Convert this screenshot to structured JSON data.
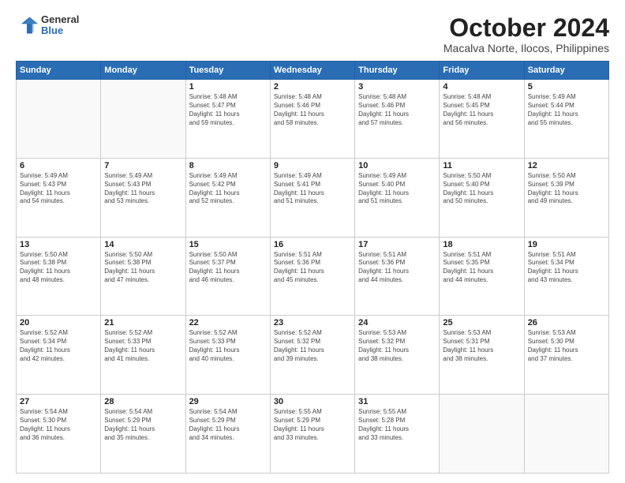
{
  "logo": {
    "general": "General",
    "blue": "Blue"
  },
  "title": {
    "month": "October 2024",
    "location": "Macalva Norte, Ilocos, Philippines"
  },
  "weekdays": [
    "Sunday",
    "Monday",
    "Tuesday",
    "Wednesday",
    "Thursday",
    "Friday",
    "Saturday"
  ],
  "weeks": [
    [
      {
        "day": "",
        "info": ""
      },
      {
        "day": "",
        "info": ""
      },
      {
        "day": "1",
        "info": "Sunrise: 5:48 AM\nSunset: 5:47 PM\nDaylight: 11 hours\nand 59 minutes."
      },
      {
        "day": "2",
        "info": "Sunrise: 5:48 AM\nSunset: 5:46 PM\nDaylight: 11 hours\nand 58 minutes."
      },
      {
        "day": "3",
        "info": "Sunrise: 5:48 AM\nSunset: 5:46 PM\nDaylight: 11 hours\nand 57 minutes."
      },
      {
        "day": "4",
        "info": "Sunrise: 5:48 AM\nSunset: 5:45 PM\nDaylight: 11 hours\nand 56 minutes."
      },
      {
        "day": "5",
        "info": "Sunrise: 5:49 AM\nSunset: 5:44 PM\nDaylight: 11 hours\nand 55 minutes."
      }
    ],
    [
      {
        "day": "6",
        "info": "Sunrise: 5:49 AM\nSunset: 5:43 PM\nDaylight: 11 hours\nand 54 minutes."
      },
      {
        "day": "7",
        "info": "Sunrise: 5:49 AM\nSunset: 5:43 PM\nDaylight: 11 hours\nand 53 minutes."
      },
      {
        "day": "8",
        "info": "Sunrise: 5:49 AM\nSunset: 5:42 PM\nDaylight: 11 hours\nand 52 minutes."
      },
      {
        "day": "9",
        "info": "Sunrise: 5:49 AM\nSunset: 5:41 PM\nDaylight: 11 hours\nand 51 minutes."
      },
      {
        "day": "10",
        "info": "Sunrise: 5:49 AM\nSunset: 5:40 PM\nDaylight: 11 hours\nand 51 minutes."
      },
      {
        "day": "11",
        "info": "Sunrise: 5:50 AM\nSunset: 5:40 PM\nDaylight: 11 hours\nand 50 minutes."
      },
      {
        "day": "12",
        "info": "Sunrise: 5:50 AM\nSunset: 5:39 PM\nDaylight: 11 hours\nand 49 minutes."
      }
    ],
    [
      {
        "day": "13",
        "info": "Sunrise: 5:50 AM\nSunset: 5:38 PM\nDaylight: 11 hours\nand 48 minutes."
      },
      {
        "day": "14",
        "info": "Sunrise: 5:50 AM\nSunset: 5:38 PM\nDaylight: 11 hours\nand 47 minutes."
      },
      {
        "day": "15",
        "info": "Sunrise: 5:50 AM\nSunset: 5:37 PM\nDaylight: 11 hours\nand 46 minutes."
      },
      {
        "day": "16",
        "info": "Sunrise: 5:51 AM\nSunset: 5:36 PM\nDaylight: 11 hours\nand 45 minutes."
      },
      {
        "day": "17",
        "info": "Sunrise: 5:51 AM\nSunset: 5:36 PM\nDaylight: 11 hours\nand 44 minutes."
      },
      {
        "day": "18",
        "info": "Sunrise: 5:51 AM\nSunset: 5:35 PM\nDaylight: 11 hours\nand 44 minutes."
      },
      {
        "day": "19",
        "info": "Sunrise: 5:51 AM\nSunset: 5:34 PM\nDaylight: 11 hours\nand 43 minutes."
      }
    ],
    [
      {
        "day": "20",
        "info": "Sunrise: 5:52 AM\nSunset: 5:34 PM\nDaylight: 11 hours\nand 42 minutes."
      },
      {
        "day": "21",
        "info": "Sunrise: 5:52 AM\nSunset: 5:33 PM\nDaylight: 11 hours\nand 41 minutes."
      },
      {
        "day": "22",
        "info": "Sunrise: 5:52 AM\nSunset: 5:33 PM\nDaylight: 11 hours\nand 40 minutes."
      },
      {
        "day": "23",
        "info": "Sunrise: 5:52 AM\nSunset: 5:32 PM\nDaylight: 11 hours\nand 39 minutes."
      },
      {
        "day": "24",
        "info": "Sunrise: 5:53 AM\nSunset: 5:32 PM\nDaylight: 11 hours\nand 38 minutes."
      },
      {
        "day": "25",
        "info": "Sunrise: 5:53 AM\nSunset: 5:31 PM\nDaylight: 11 hours\nand 38 minutes."
      },
      {
        "day": "26",
        "info": "Sunrise: 5:53 AM\nSunset: 5:30 PM\nDaylight: 11 hours\nand 37 minutes."
      }
    ],
    [
      {
        "day": "27",
        "info": "Sunrise: 5:54 AM\nSunset: 5:30 PM\nDaylight: 11 hours\nand 36 minutes."
      },
      {
        "day": "28",
        "info": "Sunrise: 5:54 AM\nSunset: 5:29 PM\nDaylight: 11 hours\nand 35 minutes."
      },
      {
        "day": "29",
        "info": "Sunrise: 5:54 AM\nSunset: 5:29 PM\nDaylight: 11 hours\nand 34 minutes."
      },
      {
        "day": "30",
        "info": "Sunrise: 5:55 AM\nSunset: 5:29 PM\nDaylight: 11 hours\nand 33 minutes."
      },
      {
        "day": "31",
        "info": "Sunrise: 5:55 AM\nSunset: 5:28 PM\nDaylight: 11 hours\nand 33 minutes."
      },
      {
        "day": "",
        "info": ""
      },
      {
        "day": "",
        "info": ""
      }
    ]
  ]
}
